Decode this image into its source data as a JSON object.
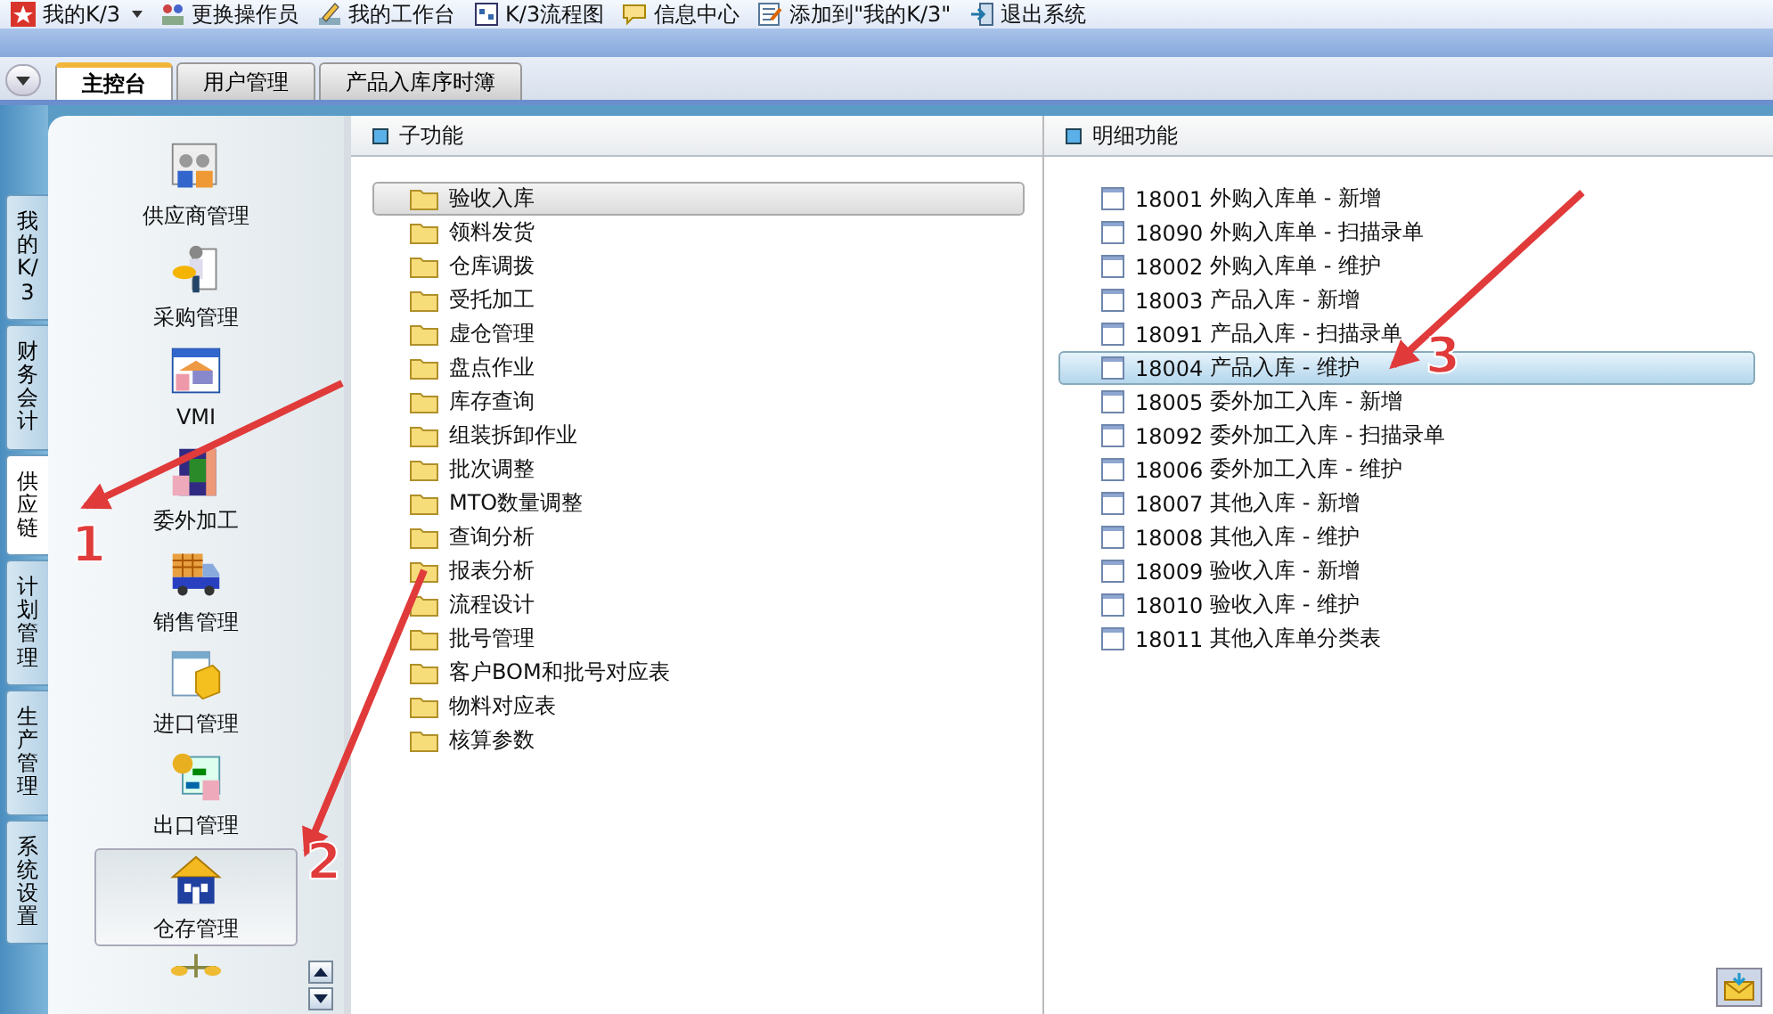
{
  "toolbar": [
    {
      "label": "我的K/3",
      "has_menu": true
    },
    {
      "label": "更换操作员",
      "has_menu": false
    },
    {
      "label": "我的工作台",
      "has_menu": false
    },
    {
      "label": "K/3流程图",
      "has_menu": false
    },
    {
      "label": "信息中心",
      "has_menu": false
    },
    {
      "label": "添加到\"我的K/3\"",
      "has_menu": false
    },
    {
      "label": "退出系统",
      "has_menu": false
    }
  ],
  "tabs": [
    {
      "label": "主控台",
      "selected": true
    },
    {
      "label": "用户管理",
      "selected": false
    },
    {
      "label": "产品入库序时簿",
      "selected": false
    }
  ],
  "side_tabs": [
    {
      "label": "我的K/3",
      "selected": false
    },
    {
      "label": "财务会计",
      "selected": false
    },
    {
      "label": "供应链",
      "selected": true
    },
    {
      "label": "计划管理",
      "selected": false
    },
    {
      "label": "生产管理",
      "selected": false
    },
    {
      "label": "系统设置",
      "selected": false
    }
  ],
  "modules": [
    {
      "label": "供应商管理",
      "selected": false
    },
    {
      "label": "采购管理",
      "selected": false
    },
    {
      "label": "VMI",
      "selected": false
    },
    {
      "label": "委外加工",
      "selected": false
    },
    {
      "label": "销售管理",
      "selected": false
    },
    {
      "label": "进口管理",
      "selected": false
    },
    {
      "label": "出口管理",
      "selected": false
    },
    {
      "label": "仓存管理",
      "selected": true
    }
  ],
  "sub_functions": {
    "title": "子功能",
    "items": [
      {
        "label": "验收入库",
        "selected": true
      },
      {
        "label": "领料发货",
        "selected": false
      },
      {
        "label": "仓库调拨",
        "selected": false
      },
      {
        "label": "受托加工",
        "selected": false
      },
      {
        "label": "虚仓管理",
        "selected": false
      },
      {
        "label": "盘点作业",
        "selected": false
      },
      {
        "label": "库存查询",
        "selected": false
      },
      {
        "label": "组装拆卸作业",
        "selected": false
      },
      {
        "label": "批次调整",
        "selected": false
      },
      {
        "label": "MTO数量调整",
        "selected": false
      },
      {
        "label": "查询分析",
        "selected": false
      },
      {
        "label": "报表分析",
        "selected": false
      },
      {
        "label": "流程设计",
        "selected": false
      },
      {
        "label": "批号管理",
        "selected": false
      },
      {
        "label": "客户BOM和批号对应表",
        "selected": false
      },
      {
        "label": "物料对应表",
        "selected": false
      },
      {
        "label": "核算参数",
        "selected": false
      }
    ]
  },
  "detail_functions": {
    "title": "明细功能",
    "items": [
      {
        "code": "18001",
        "label": "外购入库单 - 新增",
        "selected": false
      },
      {
        "code": "18090",
        "label": "外购入库单 - 扫描录单",
        "selected": false
      },
      {
        "code": "18002",
        "label": "外购入库单 - 维护",
        "selected": false
      },
      {
        "code": "18003",
        "label": "产品入库 - 新增",
        "selected": false
      },
      {
        "code": "18091",
        "label": "产品入库 - 扫描录单",
        "selected": false
      },
      {
        "code": "18004",
        "label": "产品入库 - 维护",
        "selected": true
      },
      {
        "code": "18005",
        "label": "委外加工入库 - 新增",
        "selected": false
      },
      {
        "code": "18092",
        "label": "委外加工入库 - 扫描录单",
        "selected": false
      },
      {
        "code": "18006",
        "label": "委外加工入库 - 维护",
        "selected": false
      },
      {
        "code": "18007",
        "label": "其他入库 - 新增",
        "selected": false
      },
      {
        "code": "18008",
        "label": "其他入库 - 维护",
        "selected": false
      },
      {
        "code": "18009",
        "label": "验收入库 - 新增",
        "selected": false
      },
      {
        "code": "18010",
        "label": "验收入库 - 维护",
        "selected": false
      },
      {
        "code": "18011",
        "label": "其他入库单分类表",
        "selected": false
      }
    ]
  },
  "annotations": [
    {
      "label": "1"
    },
    {
      "label": "2"
    },
    {
      "label": "3"
    }
  ]
}
